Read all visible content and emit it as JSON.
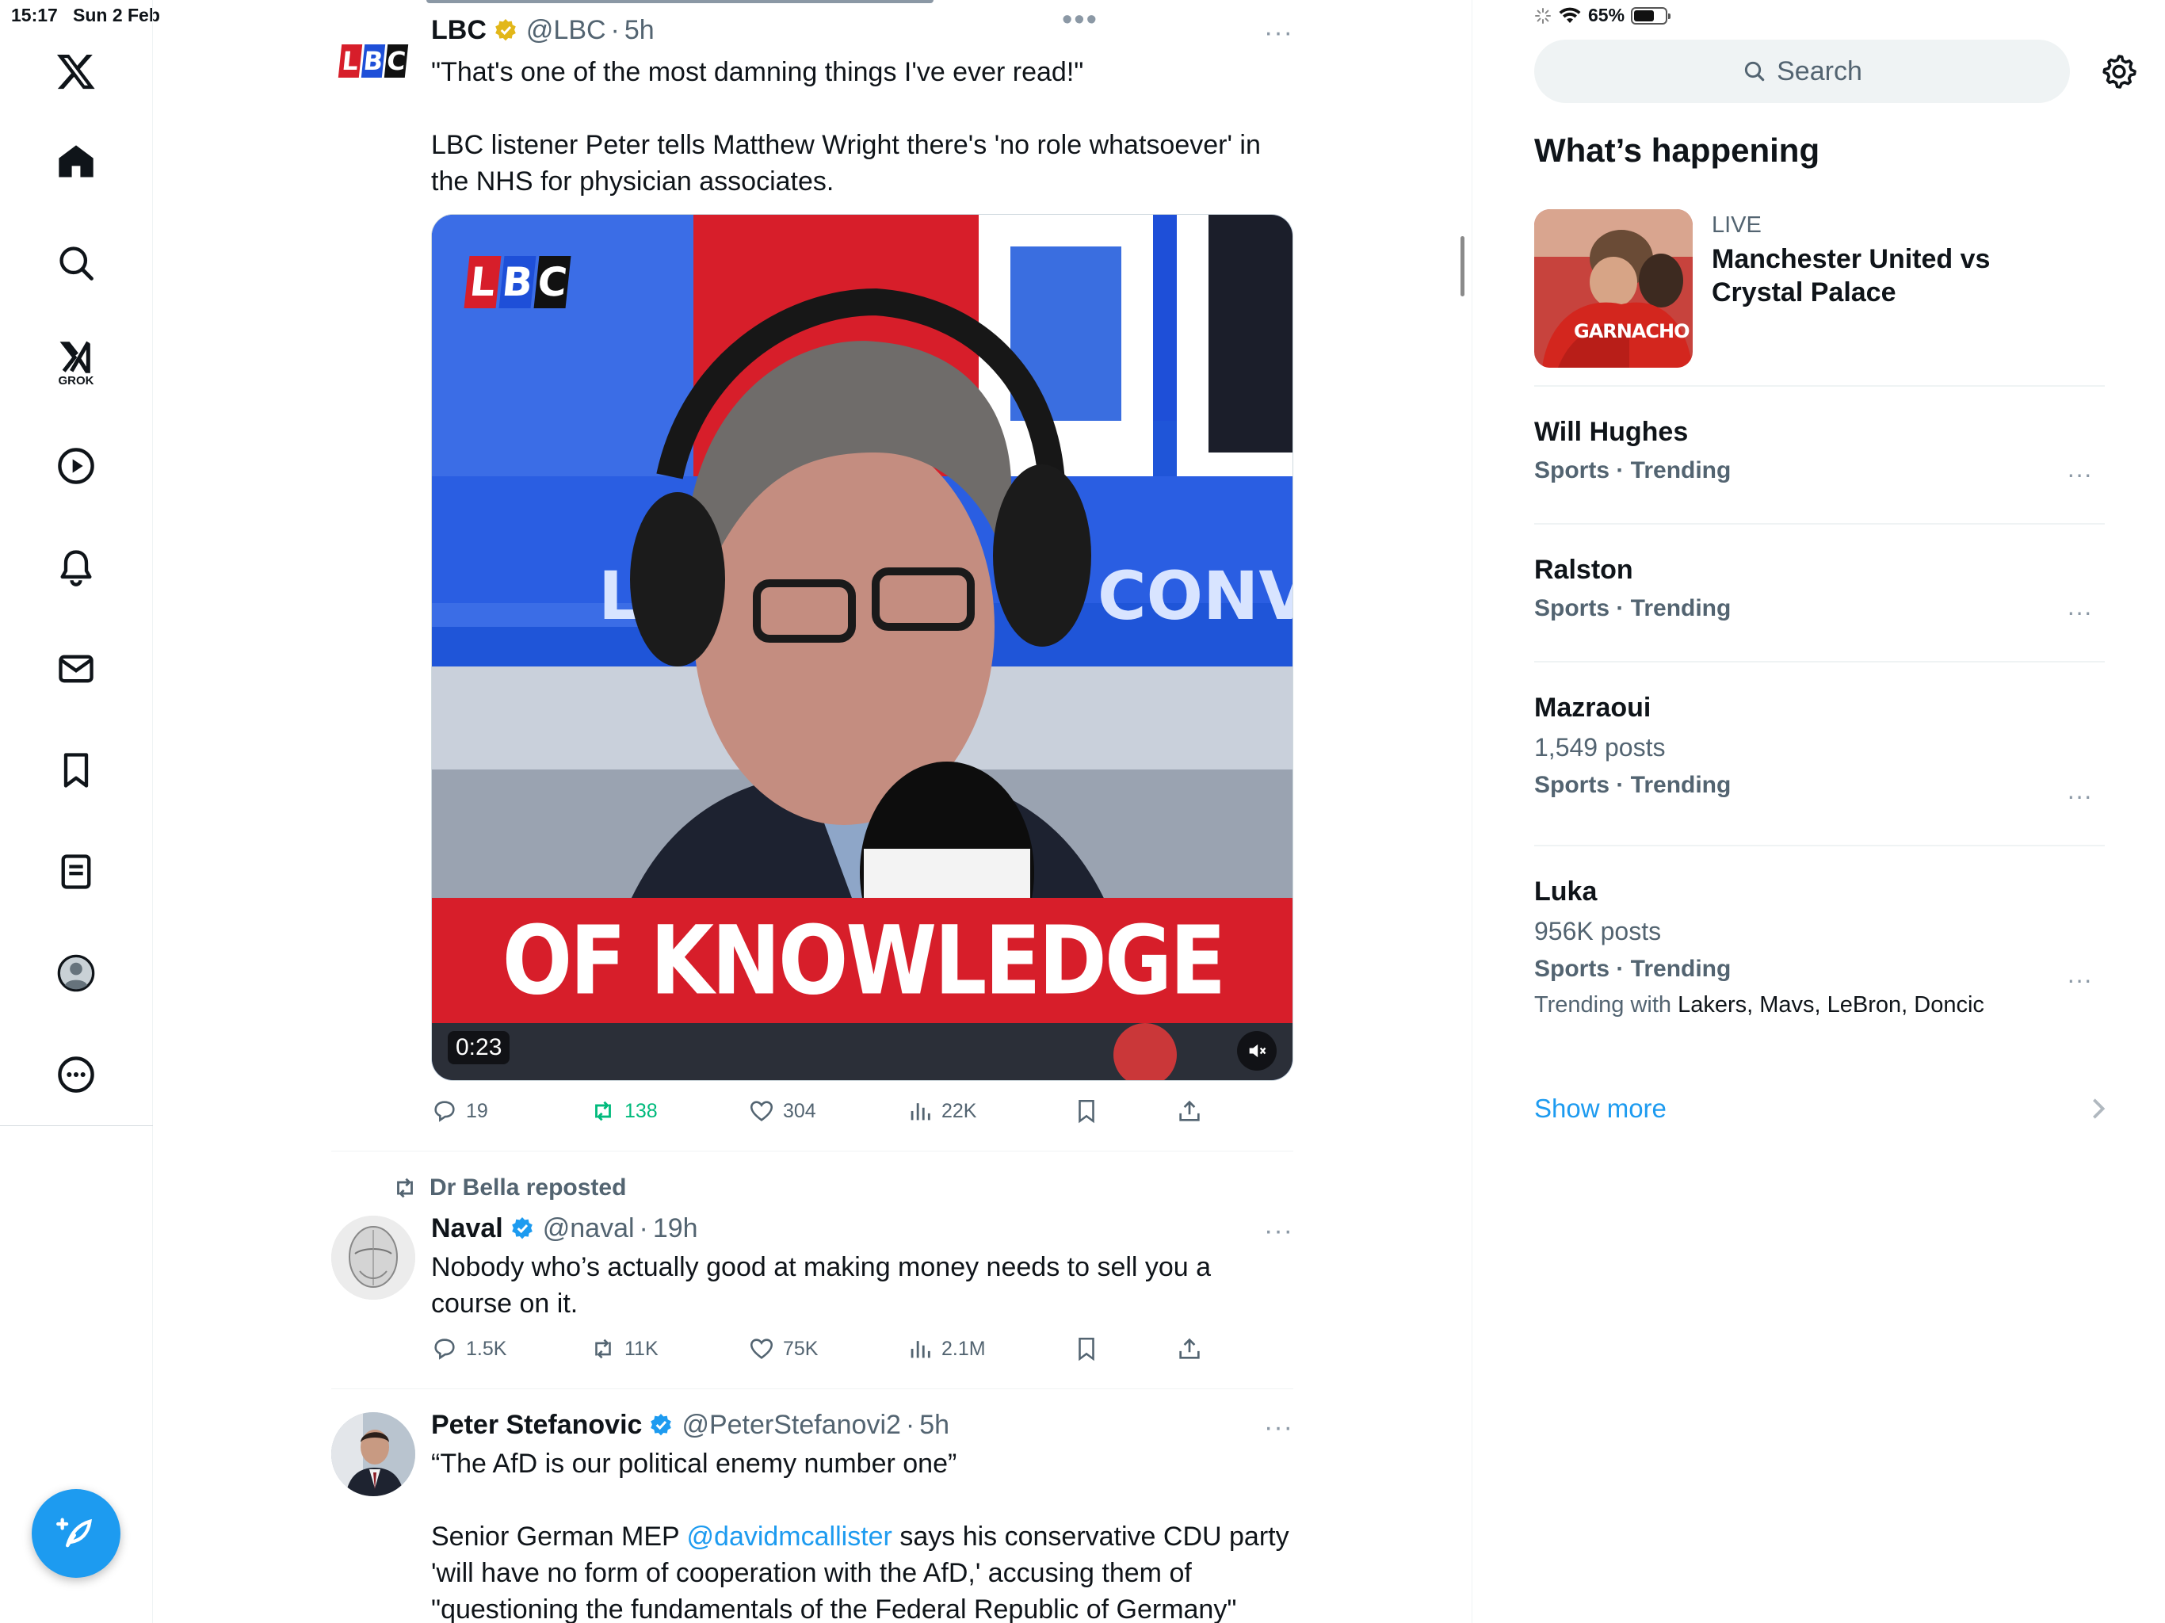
{
  "status_bar": {
    "time": "15:17",
    "date": "Sun 2 Feb",
    "battery": "65%",
    "battery_level": 0.65
  },
  "nav": {
    "grok_label": "GROK",
    "items": [
      "home-icon",
      "search-icon",
      "grok-icon",
      "video-icon",
      "notifications-icon",
      "messages-icon",
      "bookmarks-icon",
      "lists-icon",
      "profile-icon",
      "more-icon"
    ]
  },
  "feed": {
    "tweets": [
      {
        "name": "LBC",
        "handle": "@LBC",
        "time": "5h",
        "verified": "gold",
        "text": "\"That's one of the most damning things I've ever read!\"\n\nLBC listener Peter tells Matthew Wright there's 'no role whatsoever' in the NHS for physician associates.",
        "video": {
          "duration": "0:23",
          "banner_text": "OF KNOWLEDGE",
          "logo": [
            "L",
            "B",
            "C"
          ]
        },
        "stats": {
          "replies": "19",
          "reposts": "138",
          "likes": "304",
          "views": "22K"
        }
      },
      {
        "repost_by": "Dr Bella reposted",
        "name": "Naval",
        "handle": "@naval",
        "time": "19h",
        "verified": "blue",
        "text": "Nobody who’s actually good at making money needs to sell you a course on it.",
        "stats": {
          "replies": "1.5K",
          "reposts": "11K",
          "likes": "75K",
          "views": "2.1M"
        }
      },
      {
        "name": "Peter Stefanovic",
        "handle": "@PeterStefanovi2",
        "time": "5h",
        "verified": "blue",
        "text_1": "“The AfD is our political enemy number one”",
        "text_2_pre": "Senior German MEP ",
        "text_2_link": "@davidmcallister",
        "text_2_post": "  says his conservative CDU party 'will have no form of cooperation with the AfD,' accusing them of \"questioning the fundamentals of the Federal Republic of Germany\""
      }
    ]
  },
  "sidebar": {
    "search_placeholder": "Search",
    "title": "What’s happening",
    "live": {
      "label": "LIVE",
      "title": "Manchester United vs Crystal Palace",
      "thumb_text": "GARNACHO"
    },
    "trends": [
      {
        "name": "Will Hughes",
        "category": "Sports · Trending"
      },
      {
        "name": "Ralston",
        "category": "Sports · Trending"
      },
      {
        "name": "Mazraoui",
        "posts": "1,549 posts",
        "category": "Sports · Trending"
      },
      {
        "name": "Luka",
        "posts": "956K posts",
        "category": "Sports · Trending",
        "with_label": "Trending with",
        "with_items": "Lakers, Mavs, LeBron, Doncic"
      }
    ],
    "show_more": "Show more"
  },
  "colors": {
    "accent": "#1d9bf0",
    "repost_green": "#00ba7c",
    "verified_gold": "#e2b719",
    "lbc_red": "#d71e2a",
    "lbc_blue": "#1e4fd8"
  }
}
